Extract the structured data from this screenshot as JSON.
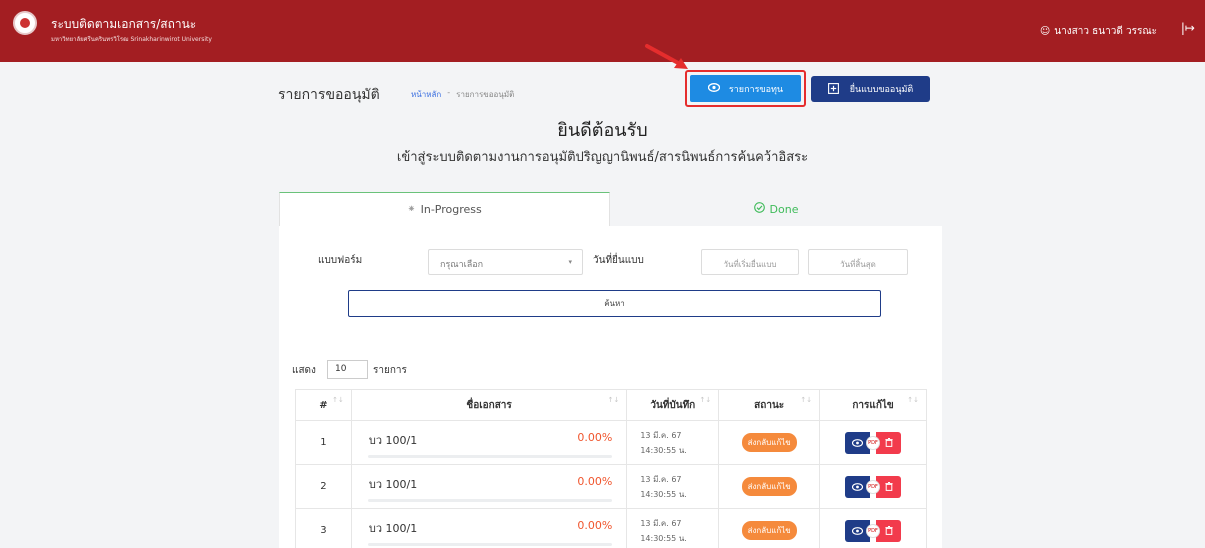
{
  "header": {
    "app_title": "ระบบติดตามเอกสาร/สถานะ",
    "app_subtitle": "มหาวิทยาลัยศรีนครินทรวิโรฒ Srinakharinwirot University",
    "user_name": "นางสาว ธนาวดี วรรณะ",
    "user_icon": "person-icon",
    "logout_icon": "logout-icon"
  },
  "page": {
    "title": "รายการขออนุมัติ",
    "breadcrumb": {
      "home": "หน้าหลัก",
      "sep": "-",
      "current": "รายการขออนุมัติ"
    },
    "btn_request_label": "รายการขอทุน",
    "btn_submit_label": "ยื่นแบบขออนุมัติ",
    "welcome": "ยินดีต้อนรับ",
    "welcome_sub": "เข้าสู่ระบบติดตามงานการอนุมัติปริญญานิพนธ์/สารนิพนธ์การค้นคว้าอิสระ"
  },
  "tabs": {
    "progress": "In-Progress",
    "done": "Done"
  },
  "filter": {
    "form_label": "แบบฟอร์ม",
    "form_placeholder": "กรุณาเลือก",
    "date_label": "วันที่ยื่นแบบ",
    "date_start_placeholder": "วันที่เริ่มยื่นแบบ",
    "date_end_placeholder": "วันที่สิ้นสุด",
    "search_label": "ค้นหา"
  },
  "listing": {
    "show_label": "แสดง",
    "page_size": "10",
    "unit_label": "รายการ"
  },
  "table": {
    "headers": {
      "num": "#",
      "doc": "ชื่อเอกสาร",
      "date": "วันที่บันทึก",
      "status": "สถานะ",
      "action": "การแก้ไข"
    },
    "rows": [
      {
        "num": "1",
        "doc": "บว 100/1",
        "pct": "0.00%",
        "progress": 0,
        "date": "13 มี.ค. 67",
        "time": "14:30:55 น.",
        "status": "ส่งกลับแก้ไข"
      },
      {
        "num": "2",
        "doc": "บว 100/1",
        "pct": "0.00%",
        "progress": 0,
        "date": "13 มี.ค. 67",
        "time": "14:30:55 น.",
        "status": "ส่งกลับแก้ไข"
      },
      {
        "num": "3",
        "doc": "บว 100/1",
        "pct": "0.00%",
        "progress": 0,
        "date": "13 มี.ค. 67",
        "time": "14:30:55 น.",
        "status": "ส่งกลับแก้ไข"
      }
    ]
  },
  "colors": {
    "header_bg": "#a31e22",
    "primary": "#1e8be3",
    "navy": "#1f3c88",
    "badge": "#f58a3c",
    "danger": "#f23b4c",
    "success": "#3fbb5a",
    "highlight": "#e52d2d"
  }
}
